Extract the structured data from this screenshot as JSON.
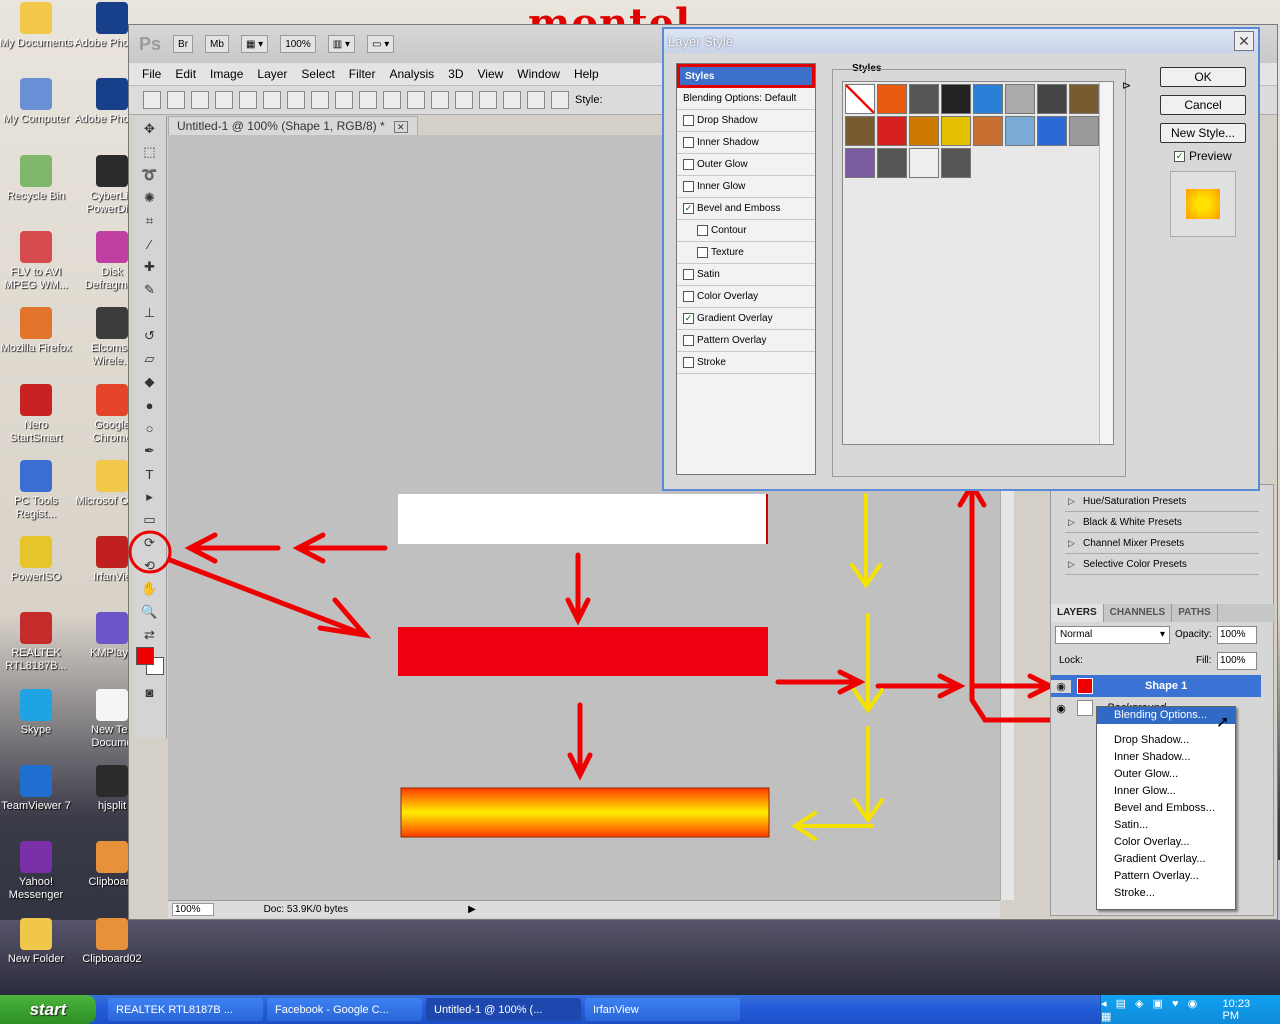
{
  "watermark": "montel",
  "desktop_icons": [
    {
      "label": "My Documents",
      "color": "#f2c84b"
    },
    {
      "label": "My Computer",
      "color": "#6b8fd6"
    },
    {
      "label": "Recycle Bin",
      "color": "#7fb86b"
    },
    {
      "label": "FLV to AVI MPEG WM...",
      "color": "#d64b4b"
    },
    {
      "label": "Mozilla Firefox",
      "color": "#e2742d"
    },
    {
      "label": "Nero StartSmart",
      "color": "#c92222"
    },
    {
      "label": "PC Tools Regist...",
      "color": "#3a6fd1"
    },
    {
      "label": "PowerISO",
      "color": "#e5c52a"
    },
    {
      "label": "REALTEK RTL8187B...",
      "color": "#c42b2b"
    },
    {
      "label": "Skype",
      "color": "#1fa3e5"
    },
    {
      "label": "TeamViewer 7",
      "color": "#1f6fd1"
    },
    {
      "label": "Yahoo! Messenger",
      "color": "#7b2fa8"
    },
    {
      "label": "New Folder",
      "color": "#f0c64b"
    }
  ],
  "desktop_icons_col2": [
    {
      "label": "Adobe Photosh",
      "color": "#173f8a"
    },
    {
      "label": "Adobe Photosh",
      "color": "#173f8a"
    },
    {
      "label": "CyberLin PowerDire",
      "color": "#2b2b2b"
    },
    {
      "label": "Disk Defragmen",
      "color": "#c03fa0"
    },
    {
      "label": "Elcomso Wirele...",
      "color": "#3b3b3b"
    },
    {
      "label": "Google Chrome",
      "color": "#e4442a"
    },
    {
      "label": "Microsof Office",
      "color": "#f2c84b"
    },
    {
      "label": "IrfanVie",
      "color": "#c02020"
    },
    {
      "label": "KMPlaye",
      "color": "#6b55c9"
    },
    {
      "label": "New Tex Docume",
      "color": "#f5f5f5"
    },
    {
      "label": "hjsplit",
      "color": "#2b2b2b"
    },
    {
      "label": "Clipboard",
      "color": "#e7913a"
    },
    {
      "label": "Clipboard02",
      "color": "#e7913a"
    }
  ],
  "photoshop": {
    "logo": "Ps",
    "title_chips": [
      "Br",
      "Mb"
    ],
    "zoom": "100%",
    "menu": [
      "File",
      "Edit",
      "Image",
      "Layer",
      "Select",
      "Filter",
      "Analysis",
      "3D",
      "View",
      "Window",
      "Help"
    ],
    "options_style_label": "Style:",
    "document_tab": "Untitled-1 @ 100% (Shape 1, RGB/8) *",
    "status_zoom": "100%",
    "status_doc": "Doc: 53.9K/0 bytes"
  },
  "adjustments_presets": [
    "Hue/Saturation Presets",
    "Black & White Presets",
    "Channel Mixer Presets",
    "Selective Color Presets"
  ],
  "layers_panel": {
    "tabs": [
      "LAYERS",
      "CHANNELS",
      "PATHS"
    ],
    "blend_mode": "Normal",
    "opacity_label": "Opacity:",
    "opacity": "100%",
    "lock_label": "Lock:",
    "fill_label": "Fill:",
    "fill": "100%",
    "layers": [
      "Shape 1",
      "Background"
    ]
  },
  "context_menu": {
    "highlighted": "Blending Options...",
    "items": [
      "Drop Shadow...",
      "Inner Shadow...",
      "Outer Glow...",
      "Inner Glow...",
      "Bevel and Emboss...",
      "Satin...",
      "Color Overlay...",
      "Gradient Overlay...",
      "Pattern Overlay...",
      "Stroke..."
    ]
  },
  "layer_style_dialog": {
    "title": "Layer Style",
    "styles_header": "Styles",
    "blending_options": "Blending Options: Default",
    "effects": [
      {
        "label": "Drop Shadow",
        "checked": false,
        "sub": false
      },
      {
        "label": "Inner Shadow",
        "checked": false,
        "sub": false
      },
      {
        "label": "Outer Glow",
        "checked": false,
        "sub": false
      },
      {
        "label": "Inner Glow",
        "checked": false,
        "sub": false
      },
      {
        "label": "Bevel and Emboss",
        "checked": true,
        "sub": false
      },
      {
        "label": "Contour",
        "checked": false,
        "sub": true
      },
      {
        "label": "Texture",
        "checked": false,
        "sub": true
      },
      {
        "label": "Satin",
        "checked": false,
        "sub": false
      },
      {
        "label": "Color Overlay",
        "checked": false,
        "sub": false
      },
      {
        "label": "Gradient Overlay",
        "checked": true,
        "sub": false
      },
      {
        "label": "Pattern Overlay",
        "checked": false,
        "sub": false
      },
      {
        "label": "Stroke",
        "checked": false,
        "sub": false
      }
    ],
    "styles_group_label": "Styles",
    "buttons": {
      "ok": "OK",
      "cancel": "Cancel",
      "new_style": "New Style..."
    },
    "preview_label": "Preview",
    "preview_checked": true,
    "swatch_colors": [
      "#ffffff",
      "#e85a10",
      "#555555",
      "#222222",
      "#2a7fd6",
      "#aaaaaa",
      "#444444",
      "#7a5a30",
      "#7a5a30",
      "#d62020",
      "#cc7a00",
      "#e5c000",
      "#c77030",
      "#7aaad6",
      "#2a6ad6",
      "#999999",
      "#7a5aa0",
      "#555555",
      "#eeeeee",
      "#555555"
    ]
  },
  "taskbar": {
    "start": "start",
    "tasks": [
      "REALTEK RTL8187B ...",
      "Facebook - Google C...",
      "Untitled-1 @ 100% (...",
      "IrfanView"
    ],
    "active_index": 2,
    "clock": "10:23 PM"
  }
}
